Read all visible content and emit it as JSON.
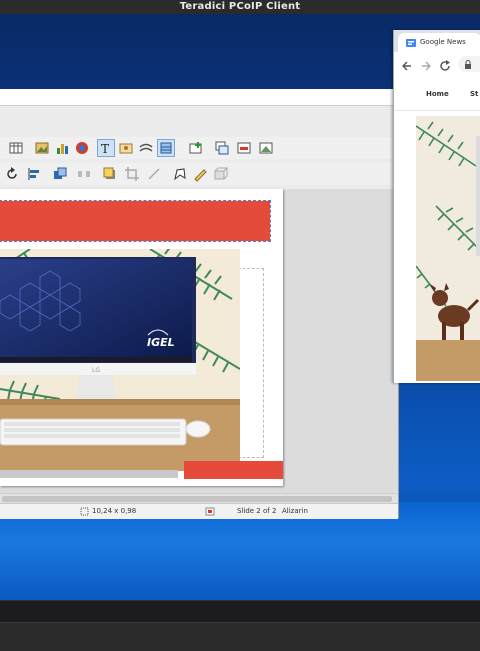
{
  "window": {
    "title": "Teradici PCoIP Client"
  },
  "impress": {
    "status": {
      "position": "10,24 x 0,98",
      "slide": "Slide 2 of 2",
      "theme": "Alizarin"
    },
    "slide": {
      "brand_text": "IGEL"
    }
  },
  "chrome": {
    "tab_title": "Google News",
    "tabs": [
      "Home",
      "St"
    ]
  },
  "colors": {
    "accent_red": "#e64a3b",
    "desktop_blue": "#0b4aa6",
    "selection_blue": "#4a7fd0"
  }
}
